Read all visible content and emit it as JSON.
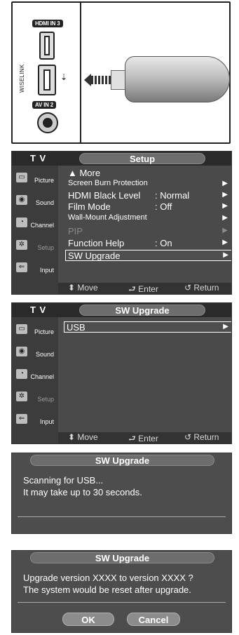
{
  "connector": {
    "hdmi_label": "HDMI IN 3",
    "wiselink_label": "WISELINK",
    "av_label": "AV IN 2"
  },
  "menu_setup": {
    "tv_label": "T V",
    "title": "Setup",
    "sidebar": [
      "Picture",
      "Sound",
      "Channel",
      "Setup",
      "Input"
    ],
    "more_label": "▲ More",
    "items": [
      {
        "label": "Screen Burn Protection",
        "value": ""
      },
      {
        "label": "HDMI Black Level",
        "value": ": Normal"
      },
      {
        "label": "Film Mode",
        "value": ": Off"
      },
      {
        "label": "Wall-Mount Adjustment",
        "value": ""
      },
      {
        "label": "PIP",
        "value": ""
      },
      {
        "label": "Function Help",
        "value": ": On"
      },
      {
        "label": "SW Upgrade",
        "value": ""
      }
    ],
    "footer": {
      "move": "Move",
      "enter": "Enter",
      "return": "Return"
    }
  },
  "menu_sw": {
    "tv_label": "T V",
    "title": "SW Upgrade",
    "sidebar": [
      "Picture",
      "Sound",
      "Channel",
      "Setup",
      "Input"
    ],
    "items": [
      {
        "label": "USB"
      }
    ],
    "footer": {
      "move": "Move",
      "enter": "Enter",
      "return": "Return"
    }
  },
  "dialog_scan": {
    "title": "SW Upgrade",
    "line1": "Scanning for USB...",
    "line2": "It may take up to 30 seconds."
  },
  "dialog_confirm": {
    "title": "SW Upgrade",
    "line1": "Upgrade version XXXX to version XXXX ?",
    "line2": "The system would be reset after upgrade.",
    "ok": "OK",
    "cancel": "Cancel"
  }
}
